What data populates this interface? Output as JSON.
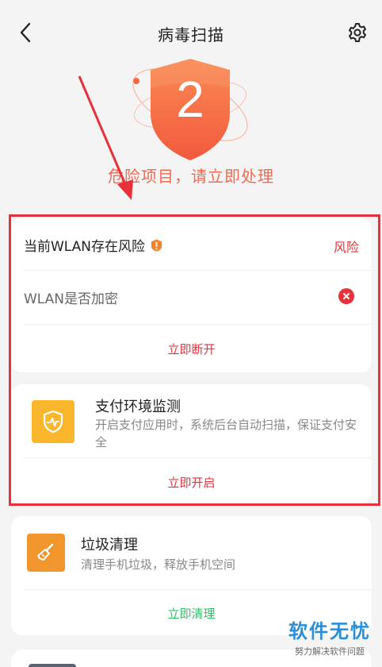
{
  "header": {
    "title": "病毒扫描"
  },
  "hero": {
    "danger_count": "2",
    "danger_text": "危险项目，请立即处理"
  },
  "wlan_card": {
    "heading": "当前WLAN存在风险",
    "risk_label": "风险",
    "item_label": "WLAN是否加密",
    "action_label": "立即断开"
  },
  "pay_card": {
    "title": "支付环境监测",
    "desc": "开启支付应用时，系统后台自动扫描，保证支付安全",
    "action_label": "立即开启"
  },
  "trash_card": {
    "title": "垃圾清理",
    "desc": "清理手机垃圾，释放手机空间",
    "action_label": "立即清理"
  },
  "watermark": {
    "main": "软件无忧",
    "sub": "努力解决软件问题"
  },
  "colors": {
    "danger": "#e8313a",
    "accent_orange": "#f26a50",
    "action_green": "#2fbe66",
    "icon_yellow": "#fbb72b",
    "icon_orange": "#f0962c"
  },
  "icons": {
    "back": "chevron-left-icon",
    "settings": "gear-icon",
    "shield": "shield-icon",
    "warning": "warning-badge-icon",
    "error": "close-circle-icon",
    "pay": "shield-pulse-icon",
    "trash": "broom-icon"
  }
}
